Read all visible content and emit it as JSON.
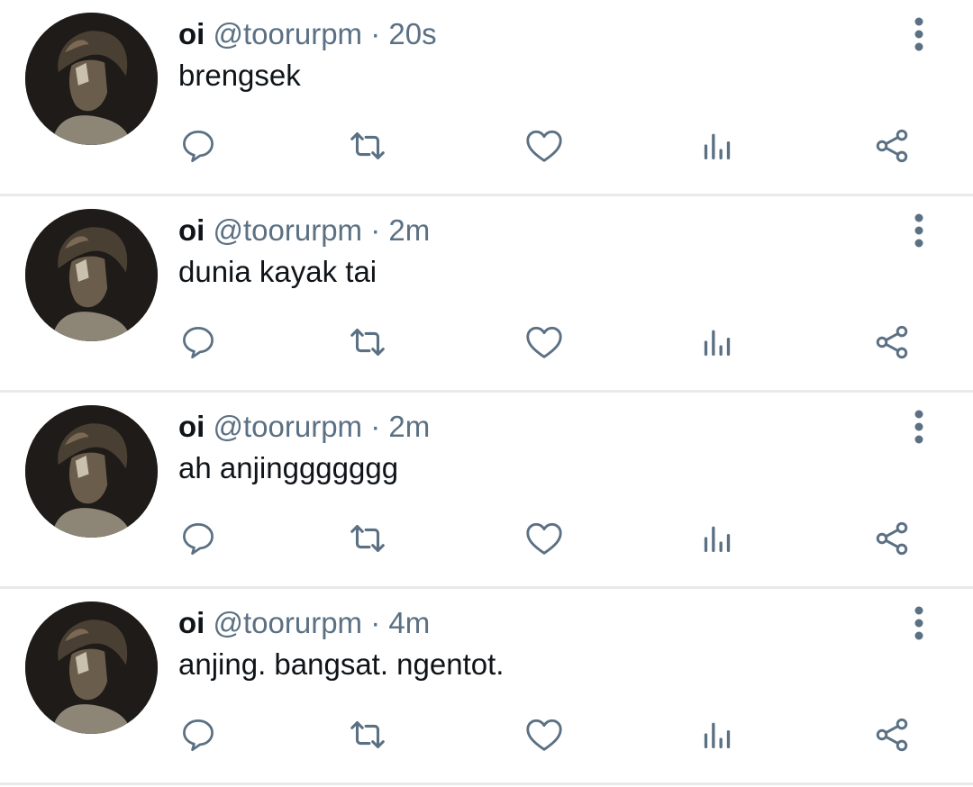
{
  "theme": {
    "text_primary": "#0f1419",
    "text_secondary": "#5b7083",
    "icon_color": "#5b7083",
    "divider": "#e7e9eb"
  },
  "tweets": [
    {
      "name": "oi",
      "handle": "@toorurpm",
      "separator": "·",
      "time": "20s",
      "text": "brengsek"
    },
    {
      "name": "oi",
      "handle": "@toorurpm",
      "separator": "·",
      "time": "2m",
      "text": "dunia kayak tai"
    },
    {
      "name": "oi",
      "handle": "@toorurpm",
      "separator": "·",
      "time": "2m",
      "text": "ah anjinggggggg"
    },
    {
      "name": "oi",
      "handle": "@toorurpm",
      "separator": "·",
      "time": "4m",
      "text": "anjing. bangsat. ngentot."
    }
  ],
  "icons": {
    "more": "more-vertical-icon",
    "reply": "reply-icon",
    "retweet": "retweet-icon",
    "like": "heart-icon",
    "analytics": "analytics-icon",
    "share": "share-icon"
  }
}
